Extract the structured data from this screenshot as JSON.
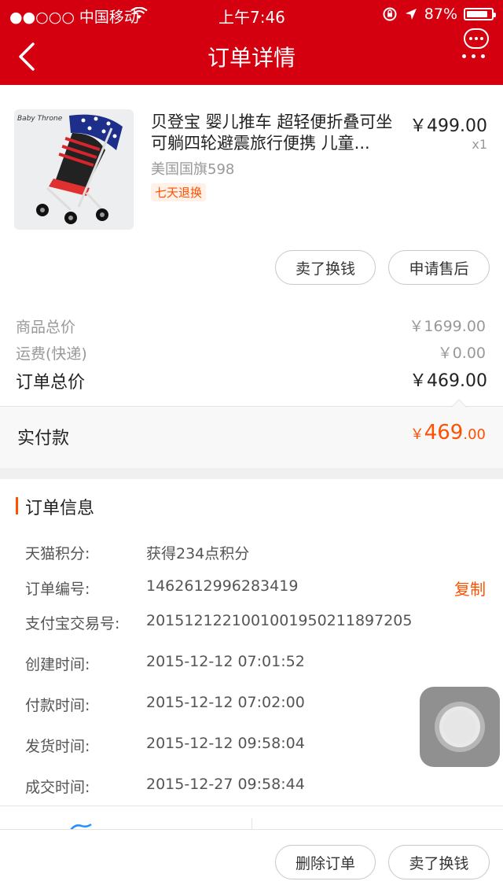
{
  "status_bar": {
    "carrier": "●●○○○ 中国移动",
    "time": "上午7:46",
    "battery": "87%",
    "battery_level": 0.87
  },
  "nav": {
    "title": "订单详情"
  },
  "product": {
    "image_brand": "Baby Throne",
    "title": "贝登宝 婴儿推车 超轻便折叠可坐可躺四轮避震旅行便携 儿童...",
    "price": "￥499.00",
    "quantity": "x1",
    "sku": "美国国旗598",
    "tag": "七天退换"
  },
  "item_actions": {
    "sell": "卖了换钱",
    "after_sales": "申请售后"
  },
  "summary": {
    "goods_total_label": "商品总价",
    "goods_total_value": "￥1699.00",
    "shipping_label": "运费(快递)",
    "shipping_value": "￥0.00",
    "order_total_label": "订单总价",
    "order_total_value": "￥469.00",
    "paid_label": "实付款",
    "paid_currency": "￥",
    "paid_int": "469",
    "paid_dec": ".00"
  },
  "order_info": {
    "title": "订单信息",
    "copy_label": "复制",
    "rows": [
      {
        "label": "天猫积分:",
        "value": "获得234点积分"
      },
      {
        "label": "订单编号:",
        "value": "1462612996283419"
      },
      {
        "label": "支付宝交易号:",
        "value": "2015121221001001950211897205"
      },
      {
        "label": "创建时间:",
        "value": "2015-12-12 07:01:52"
      },
      {
        "label": "付款时间:",
        "value": "2015-12-12 07:02:00"
      },
      {
        "label": "发货时间:",
        "value": "2015-12-12 09:58:04"
      },
      {
        "label": "成交时间:",
        "value": "2015-12-27 09:58:44"
      }
    ]
  },
  "bottom_actions": {
    "delete": "删除订单",
    "sell": "卖了换钱"
  },
  "colors": {
    "header": "#d5000f",
    "accent": "#ff5000"
  }
}
